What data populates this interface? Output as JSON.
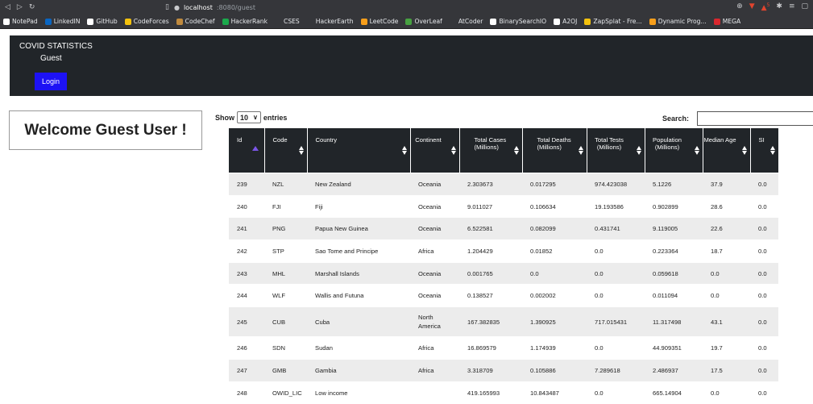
{
  "browser": {
    "url_host": "localhost",
    "url_path": ":8080/guest",
    "shield_count": "5"
  },
  "bookmarks": [
    {
      "label": "NotePad",
      "color": "#ffffff"
    },
    {
      "label": "LinkedIN",
      "color": "#0a66c2"
    },
    {
      "label": "GitHub",
      "color": "#ffffff"
    },
    {
      "label": "CodeForces",
      "color": "#f4c20d"
    },
    {
      "label": "CodeChef",
      "color": "#c08a3e"
    },
    {
      "label": "HackerRank",
      "color": "#1ba94c"
    },
    {
      "label": "CSES",
      "color": "#35363a"
    },
    {
      "label": "HackerEarth",
      "color": "#35363a"
    },
    {
      "label": "LeetCode",
      "color": "#f89f1b"
    },
    {
      "label": "OverLeaf",
      "color": "#47a141"
    },
    {
      "label": "AtCoder",
      "color": "#35363a"
    },
    {
      "label": "BinarySearchIO",
      "color": "#ffffff"
    },
    {
      "label": "A2OJ",
      "color": "#ffffff"
    },
    {
      "label": "ZapSplat - Fre...",
      "color": "#f4c20d"
    },
    {
      "label": "Dynamic Prog...",
      "color": "#f89f1b"
    },
    {
      "label": "MEGA",
      "color": "#d9272e"
    }
  ],
  "header": {
    "title": "COVID STATISTICS",
    "user": "Guest",
    "login_label": "Login"
  },
  "welcome": "Welcome Guest User !",
  "controls": {
    "show_label": "Show",
    "entries_value": "10",
    "entries_label": "entries",
    "search_label": "Search:"
  },
  "table": {
    "columns": [
      "Id",
      "Code",
      "Country",
      "Continent",
      "Total Cases (Millions)",
      "Total Deaths (Millions)",
      "Total Tests (Millions)",
      "Population (Millions)",
      "Median Age",
      "SI"
    ],
    "rows": [
      [
        "239",
        "NZL",
        "New Zealand",
        "Oceania",
        "2.303673",
        "0.017295",
        "974.423038",
        "5.1226",
        "37.9",
        "0.0"
      ],
      [
        "240",
        "FJI",
        "Fiji",
        "Oceania",
        "9.011027",
        "0.106634",
        "19.193586",
        "0.902899",
        "28.6",
        "0.0"
      ],
      [
        "241",
        "PNG",
        "Papua New Guinea",
        "Oceania",
        "6.522581",
        "0.082099",
        "0.431741",
        "9.119005",
        "22.6",
        "0.0"
      ],
      [
        "242",
        "STP",
        "Sao Tome and Principe",
        "Africa",
        "1.204429",
        "0.01852",
        "0.0",
        "0.223364",
        "18.7",
        "0.0"
      ],
      [
        "243",
        "MHL",
        "Marshall Islands",
        "Oceania",
        "0.001765",
        "0.0",
        "0.0",
        "0.059618",
        "0.0",
        "0.0"
      ],
      [
        "244",
        "WLF",
        "Wallis and Futuna",
        "Oceania",
        "0.138527",
        "0.002002",
        "0.0",
        "0.011094",
        "0.0",
        "0.0"
      ],
      [
        "245",
        "CUB",
        "Cuba",
        "North America",
        "167.382835",
        "1.390925",
        "717.015431",
        "11.317498",
        "43.1",
        "0.0"
      ],
      [
        "246",
        "SDN",
        "Sudan",
        "Africa",
        "16.869579",
        "1.174939",
        "0.0",
        "44.909351",
        "19.7",
        "0.0"
      ],
      [
        "247",
        "GMB",
        "Gambia",
        "Africa",
        "3.318709",
        "0.105886",
        "7.289618",
        "2.486937",
        "17.5",
        "0.0"
      ],
      [
        "248",
        "OWID_LIC",
        "Low income",
        "",
        "419.165993",
        "10.843487",
        "0.0",
        "665.14904",
        "0.0",
        "0.0"
      ]
    ]
  }
}
